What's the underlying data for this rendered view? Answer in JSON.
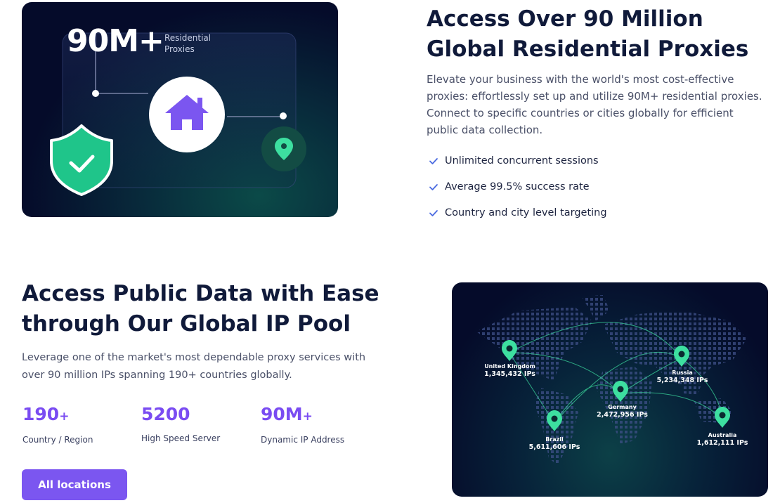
{
  "hero": {
    "big_stat": "90M+",
    "small_text": "Residential Proxies",
    "colors": {
      "shield": "#3ddfa0",
      "house": "#7b56f0",
      "pin": "#3ddfa0"
    }
  },
  "section1": {
    "title": "Access Over 90 Million Global Residential Proxies",
    "description": "Elevate your business with the world's most cost-effective proxies: effortlessly set up and utilize 90M+ residential proxies. Connect to specific countries or cities globally for efficient public data collection.",
    "features": [
      "Unlimited concurrent sessions",
      "Average 99.5% success rate",
      "Country and city level targeting"
    ]
  },
  "section2": {
    "title": "Access Public Data with Ease through Our Global IP Pool",
    "description": "Leverage one of the market's most dependable proxy services with over 90 million IPs spanning 190+ countries globally.",
    "stats": [
      {
        "value": "190",
        "suffix": "+",
        "label": "Country / Region"
      },
      {
        "value": "5200",
        "suffix": "",
        "label": "High Speed Server"
      },
      {
        "value": "90M",
        "suffix": "+",
        "label": "Dynamic IP Address"
      }
    ],
    "button_label": "All locations"
  },
  "map": {
    "locations": [
      {
        "name": "United Kingdom",
        "ips": "1,345,432 IPs"
      },
      {
        "name": "Russia",
        "ips": "5,234,348 IPs"
      },
      {
        "name": "Germany",
        "ips": "2,472,956 IPs"
      },
      {
        "name": "Brazil",
        "ips": "5,611,606 IPs"
      },
      {
        "name": "Australia",
        "ips": "1,612,111 IPs"
      }
    ],
    "accent_color": "#3ddfa0"
  }
}
